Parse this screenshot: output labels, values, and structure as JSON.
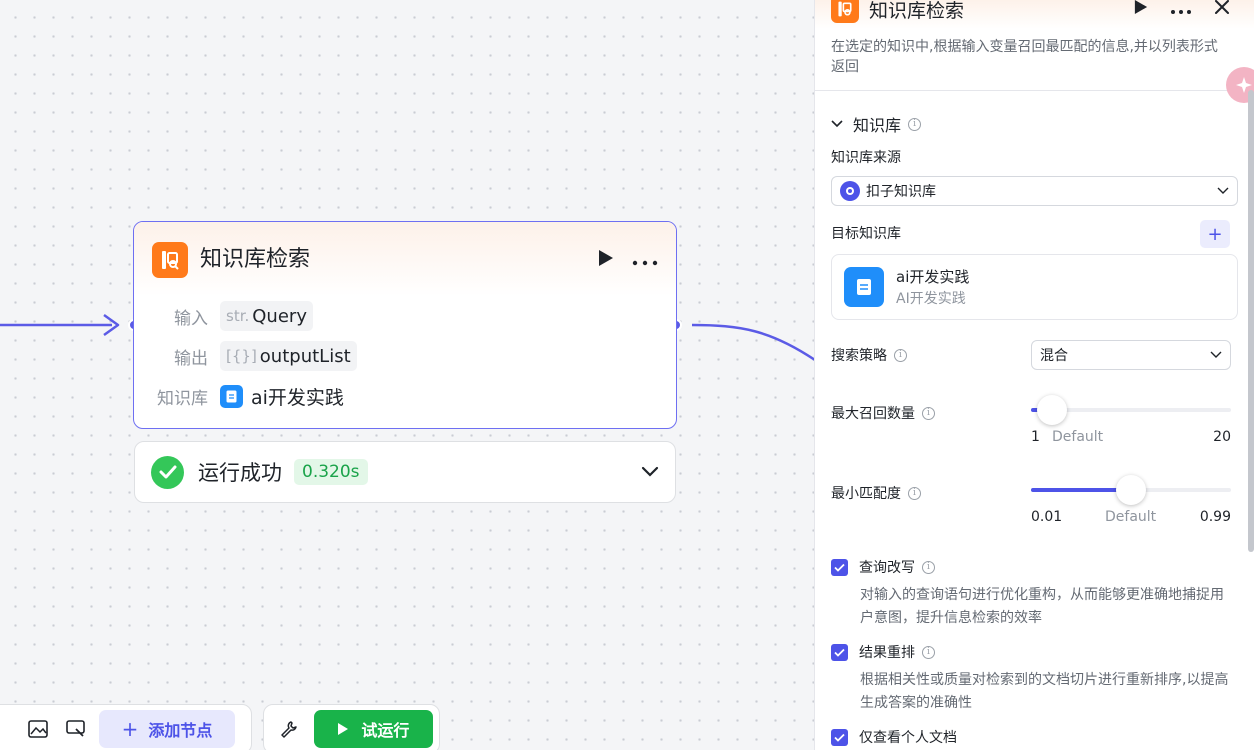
{
  "node": {
    "title": "知识库检索",
    "input_label": "输入",
    "input_type": "str.",
    "input_value": "Query",
    "output_label": "输出",
    "output_type": "[{}]",
    "output_value": "outputList",
    "kb_label": "知识库",
    "kb_value": "ai开发实践"
  },
  "result": {
    "status": "运行成功",
    "time": "0.320s"
  },
  "toolbar": {
    "add_node": "添加节点",
    "test_run": "试运行"
  },
  "panel": {
    "title": "知识库检索",
    "description": "在选定的知识中,根据输入变量召回最匹配的信息,并以列表形式返回",
    "section_title": "知识库",
    "source_label": "知识库来源",
    "source_value": "扣子知识库",
    "target_label": "目标知识库",
    "kb_name": "ai开发实践",
    "kb_desc": "AI开发实践",
    "strategy_label": "搜索策略",
    "strategy_value": "混合",
    "max_recall": {
      "label": "最大召回数量",
      "min": "1",
      "default_label": "Default",
      "max": "20",
      "value": 3
    },
    "min_match": {
      "label": "最小匹配度",
      "min": "0.01",
      "default_label": "Default",
      "max": "0.99",
      "value": 0.5
    },
    "query_rewrite": {
      "label": "查询改写",
      "checked": true,
      "desc": "对输入的查询语句进行优化重构，从而能够更准确地捕捉用户意图，提升信息检索的效率"
    },
    "rerank": {
      "label": "结果重排",
      "checked": true,
      "desc": "根据相关性或质量对检索到的文档切片进行重新排序,以提高生成答案的准确性"
    },
    "personal_only": {
      "label": "仅查看个人文档",
      "checked": true
    }
  },
  "colors": {
    "accent": "#4d53e8",
    "node_icon": "#ff7a1a",
    "success": "#34c759",
    "run_button": "#19b34a"
  }
}
